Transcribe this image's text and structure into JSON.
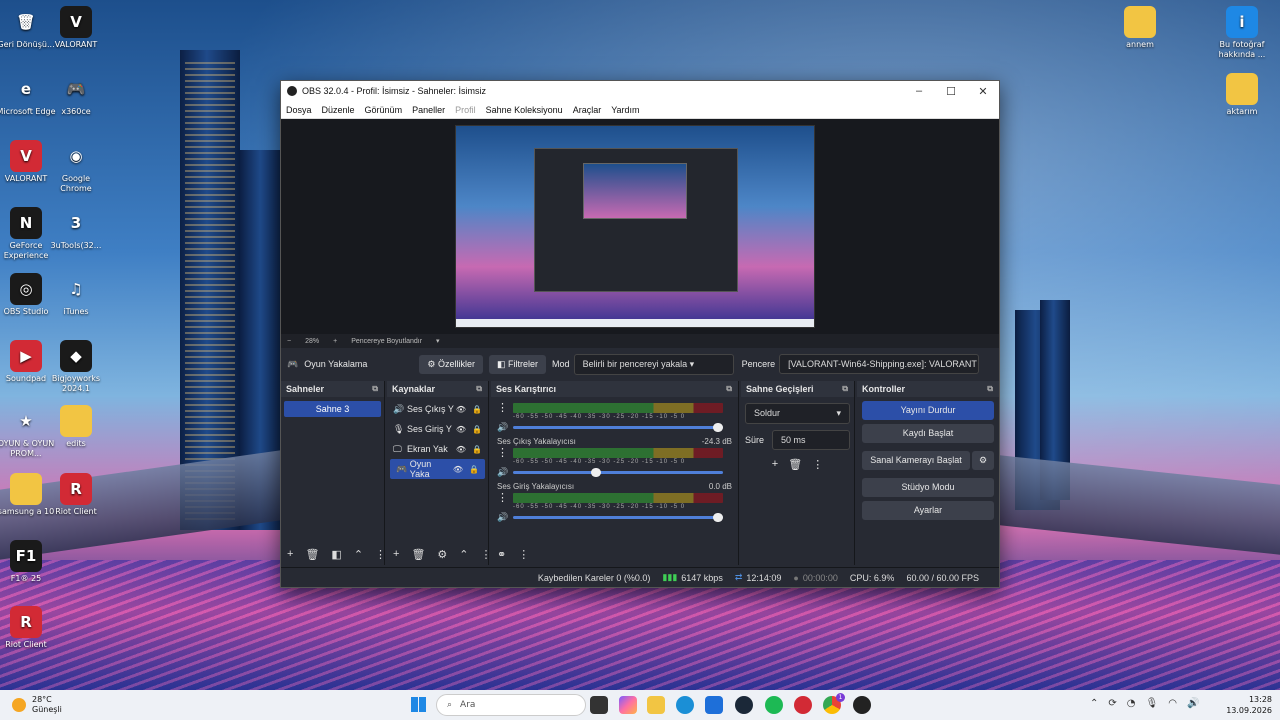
{
  "desktop": {
    "icons_left": [
      {
        "label": "Geri Dönüşü...",
        "glyph": "🗑",
        "style": "plain"
      },
      {
        "label": "VALORANT",
        "glyph": "V",
        "style": "dark"
      },
      {
        "label": "Microsoft Edge",
        "glyph": "e",
        "style": "plain"
      },
      {
        "label": "x360ce",
        "glyph": "🎮",
        "style": "plain"
      },
      {
        "label": "VALORANT",
        "glyph": "V",
        "style": "red"
      },
      {
        "label": "Google Chrome",
        "glyph": "◉",
        "style": "plain"
      },
      {
        "label": "GeForce Experience",
        "glyph": "N",
        "style": "dark"
      },
      {
        "label": "3uTools(32...",
        "glyph": "3",
        "style": "plain"
      },
      {
        "label": "OBS Studio",
        "glyph": "◎",
        "style": "dark"
      },
      {
        "label": "iTunes",
        "glyph": "♫",
        "style": "plain"
      },
      {
        "label": "Soundpad",
        "glyph": "▶",
        "style": "red"
      },
      {
        "label": "Bigjoyworks 2024.1",
        "glyph": "◆",
        "style": "dark"
      },
      {
        "label": "OYUN & OYUN PROM...",
        "glyph": "★",
        "style": "plain"
      },
      {
        "label": "edits",
        "glyph": "",
        "style": "folder"
      },
      {
        "label": "samsung a 10",
        "glyph": "",
        "style": "folder"
      },
      {
        "label": "Riot Client",
        "glyph": "R",
        "style": "red"
      },
      {
        "label": "F1® 25",
        "glyph": "F1",
        "style": "dark"
      },
      {
        "label": "Riot Client",
        "glyph": "R",
        "style": "red"
      }
    ],
    "icons_right": [
      {
        "label": "annem",
        "glyph": "",
        "style": "folder"
      },
      {
        "label": "Bu fotoğraf hakkında ...",
        "glyph": "i",
        "style": "plain"
      },
      {
        "label": "aktarım",
        "glyph": "",
        "style": "folder"
      }
    ]
  },
  "obs": {
    "title": "OBS 32.0.4 - Profil: İsimsiz - Sahneler: İsimsiz",
    "window_controls": [
      "–",
      "☐",
      "✕"
    ],
    "menu": [
      "Dosya",
      "Düzenle",
      "Görünüm",
      "Paneller",
      "Profil",
      "Sahne Koleksiyonu",
      "Araçlar",
      "Yardım"
    ],
    "zoom": {
      "minus": "−",
      "value": "28%",
      "plus": "+",
      "fit": "Pencereye Boyutlandır"
    },
    "source_bar": {
      "source_name": "Oyun Yakalama",
      "properties": "Özellikler",
      "filters": "Filtreler",
      "mode_label": "Mod",
      "mode_value": "Belirli bir pencereyi yakala",
      "window_label": "Pencere",
      "window_value": "[VALORANT-Win64-Shipping.exe]: VALORANT"
    },
    "docks": {
      "scenes": {
        "title": "Sahneler",
        "items": [
          "Sahne 3"
        ]
      },
      "sources": {
        "title": "Kaynaklar",
        "items": [
          {
            "icon": "🔊",
            "label": "Ses Çıkış Y"
          },
          {
            "icon": "🎙",
            "label": "Ses Giriş Y"
          },
          {
            "icon": "🖵",
            "label": "Ekran Yak"
          },
          {
            "icon": "🎮",
            "label": "Oyun Yaka"
          }
        ]
      },
      "mixer": {
        "title": "Ses Karıştırıcı",
        "channels": [
          {
            "name": "",
            "db": "",
            "volume": 1.0
          },
          {
            "name": "Ses Çıkış Yakalayıcısı",
            "db": "-24.3 dB",
            "volume": 0.42
          },
          {
            "name": "Ses Giriş Yakalayıcısı",
            "db": "0.0 dB",
            "volume": 1.0
          }
        ],
        "scale": "-60 -55 -50 -45 -40 -35 -30 -25 -20 -15 -10 -5 0"
      },
      "transitions": {
        "title": "Sahne Geçişleri",
        "type": "Soldur",
        "duration_label": "Süre",
        "duration_value": "50 ms"
      },
      "controls": {
        "title": "Kontroller",
        "buttons": [
          "Yayını Durdur",
          "Kaydı Başlat",
          "Sanal Kamerayı Başlat",
          "Stüdyo Modu",
          "Ayarlar"
        ]
      }
    },
    "status": {
      "dropped": "Kaybedilen Kareler 0 (%0.0)",
      "bitrate": "6147 kbps",
      "live_time": "12:14:09",
      "rec_time": "00:00:00",
      "cpu": "CPU: 6.9%",
      "fps": "60.00 / 60.00 FPS"
    }
  },
  "taskbar": {
    "weather_temp": "28°C",
    "weather_desc": "Güneşli",
    "search_placeholder": "Ara",
    "time": "13:28",
    "date": "13.09.2026",
    "badge": "1"
  },
  "colors": {
    "accent": "#2c4fa8",
    "obs_bg": "#272a33",
    "live_green": "#3fcf55"
  }
}
